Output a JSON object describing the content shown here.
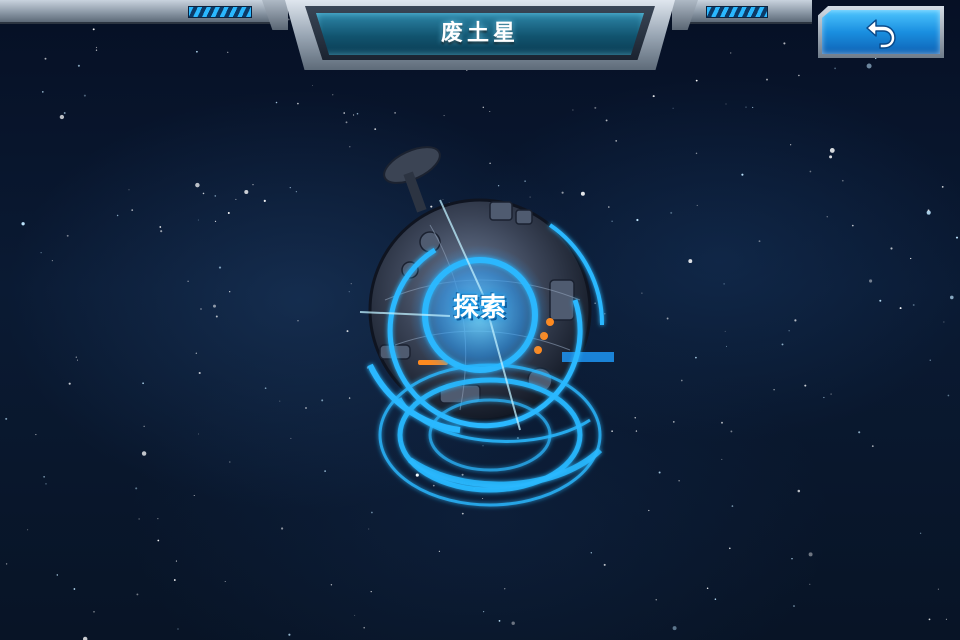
{
  "header": {
    "title": "废土星"
  },
  "back_button": {
    "icon": "undo-arrow-icon"
  },
  "planet": {
    "explore_label": "探索"
  },
  "colors": {
    "accent_cyan": "#2ab8ff",
    "hud_blue": "#1e9cff",
    "button_blue": "#1a8fe0",
    "space_dark": "#061025",
    "hud_orange": "#ff8a1f"
  }
}
